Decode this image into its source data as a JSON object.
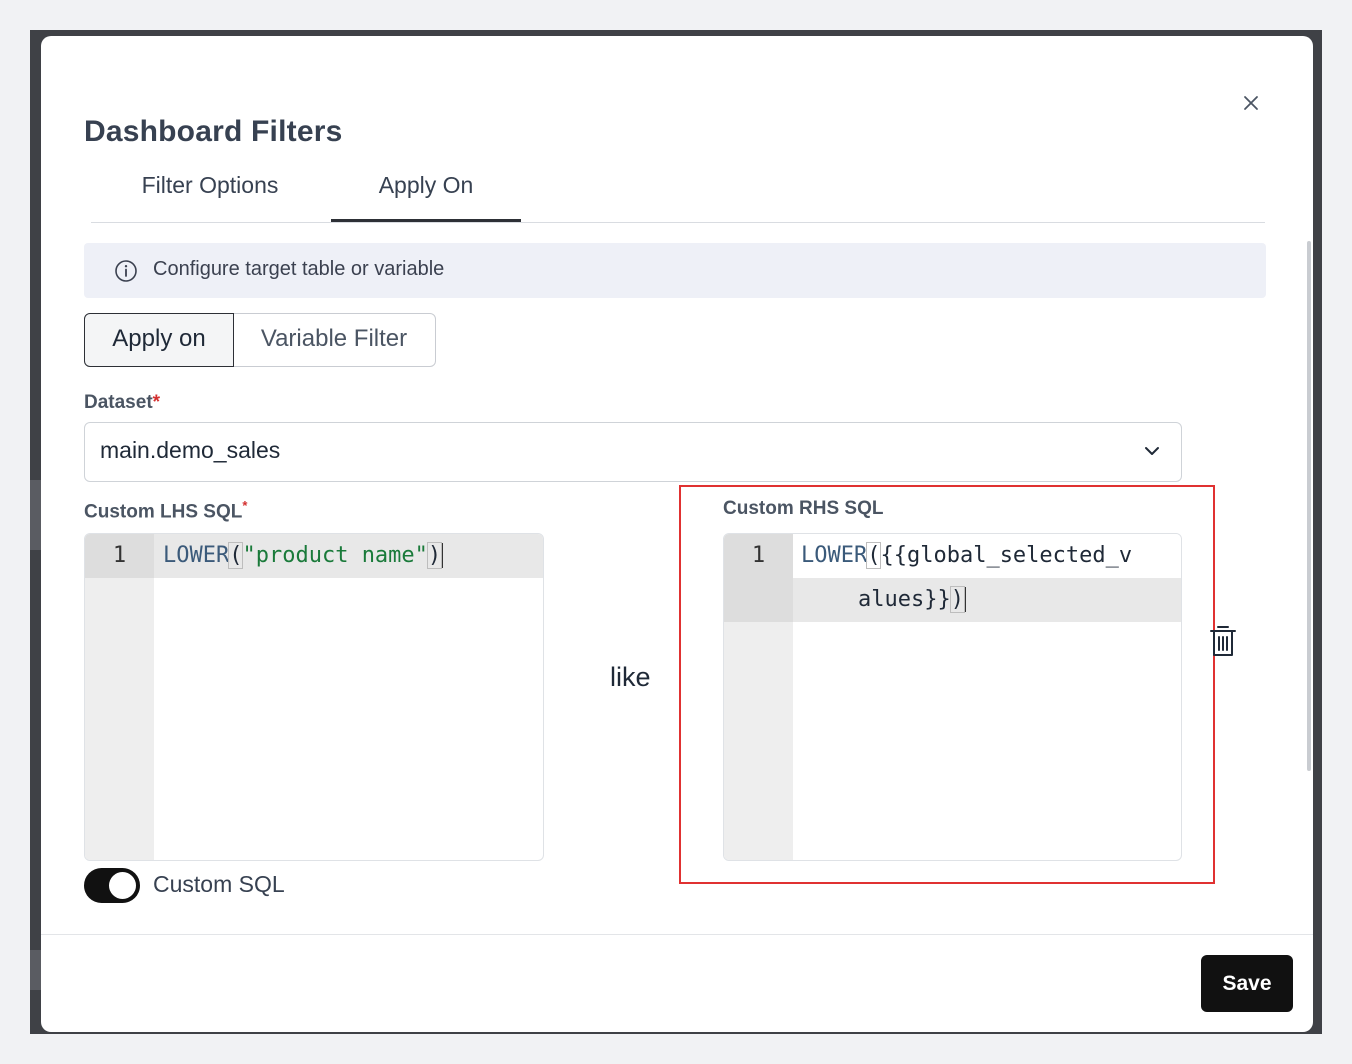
{
  "modal": {
    "title": "Dashboard Filters",
    "close_icon": "close-icon"
  },
  "tabs": [
    {
      "label": "Filter Options",
      "active": false
    },
    {
      "label": "Apply On",
      "active": true
    }
  ],
  "info": {
    "icon": "info-icon",
    "text": "Configure target table or variable"
  },
  "segmented": {
    "apply_on": "Apply on",
    "variable_filter": "Variable Filter",
    "selected": "Apply on"
  },
  "dataset": {
    "label": "Dataset",
    "required_mark": "*",
    "value": "main.demo_sales"
  },
  "lhs": {
    "label": "Custom LHS SQL",
    "required_mark": "*",
    "line_number": "1",
    "code": {
      "fn": "LOWER",
      "open": "(",
      "arg": "\"product name\"",
      "close": ")"
    }
  },
  "operator": "like",
  "rhs": {
    "label": "Custom RHS SQL",
    "line_number": "1",
    "code": {
      "fn": "LOWER",
      "open": "(",
      "arg_line1": "{{global_selected_v",
      "arg_line2": "alues}}",
      "close": ")"
    }
  },
  "custom_sql_toggle": {
    "label": "Custom SQL",
    "on": true
  },
  "footer": {
    "save_label": "Save"
  },
  "colors": {
    "primary": "#111111",
    "highlight_border": "#e03131",
    "required": "#d32f2f"
  }
}
